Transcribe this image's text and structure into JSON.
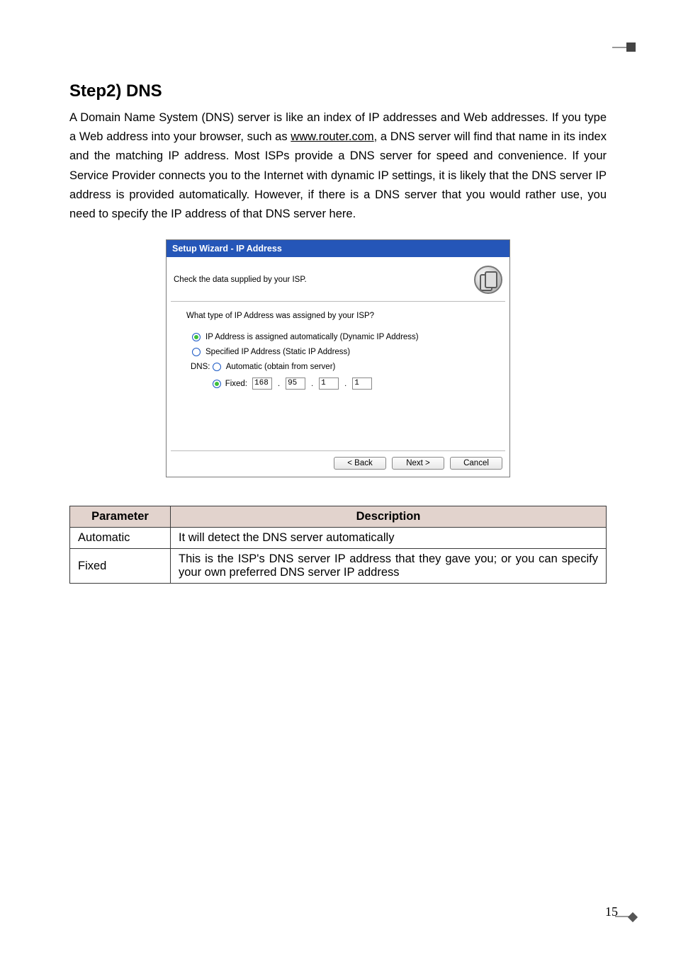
{
  "heading": "Step2) DNS",
  "body_text_parts": {
    "p1": "A Domain Name System (DNS) server is like an index of IP addresses and Web addresses. If you type a Web address into your browser, such as ",
    "link": "www.router.com",
    "p2": ", a DNS server will find that name in its index and the matching IP address. Most ISPs provide a DNS server for speed and convenience. If your Service Provider connects you to the Internet with dynamic IP settings, it is likely that the DNS server IP address is provided automatically. However, if there is a DNS server that you would rather use, you need to specify the IP address of that DNS server here."
  },
  "wizard": {
    "title": "Setup Wizard - IP Address",
    "subtitle": "Check the data supplied by your ISP.",
    "question": "What type of IP Address was assigned by your ISP?",
    "opt_dynamic": "IP Address is assigned automatically (Dynamic IP Address)",
    "opt_static": "Specified IP Address (Static IP Address)",
    "dns_label": "DNS:",
    "dns_auto": "Automatic (obtain from server)",
    "dns_fixed_label": "Fixed:",
    "ip": [
      "168",
      "95",
      "1",
      "1"
    ],
    "buttons": {
      "back": "< Back",
      "next": "Next >",
      "cancel": "Cancel"
    }
  },
  "table": {
    "headers": {
      "param": "Parameter",
      "desc": "Description"
    },
    "rows": [
      {
        "param": "Automatic",
        "desc": "It will detect the DNS server automatically"
      },
      {
        "param": "Fixed",
        "desc": "This is the ISP's DNS server IP address that they gave you; or you can specify your own preferred DNS server IP address"
      }
    ]
  },
  "page_number": "15"
}
